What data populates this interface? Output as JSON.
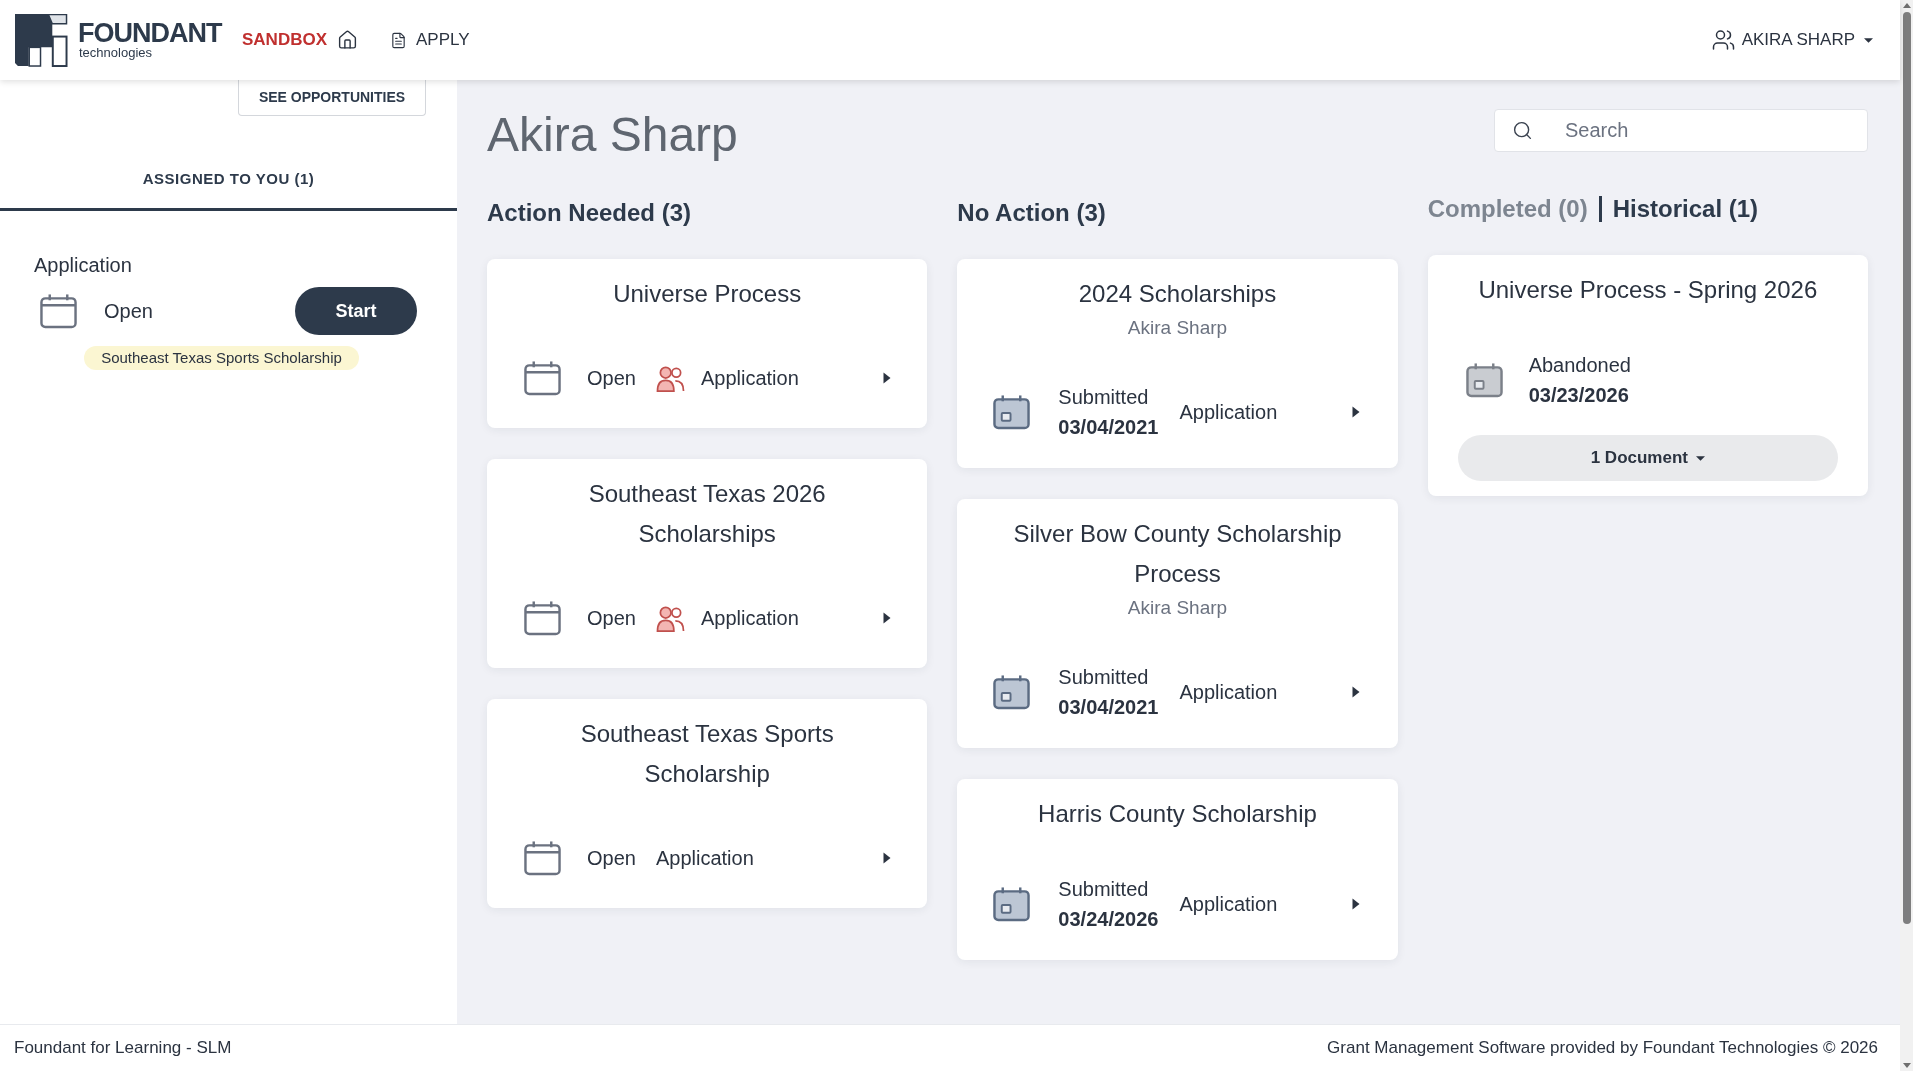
{
  "header": {
    "brand": {
      "name": "FOUNDANT",
      "tagline": "technologies"
    },
    "environment": "SANDBOX",
    "nav_links": [
      "APPLY"
    ],
    "user_menu": "AKIRA SHARP"
  },
  "sidebar": {
    "button": "SEE OPPORTUNITIES",
    "tabs": [
      {
        "label": "ASSIGNED TO YOU (1)",
        "selected": true
      }
    ],
    "tasks": [
      {
        "type": "Application",
        "status": "Open",
        "action": "Start",
        "tag": "Southeast Texas Sports Scholarship"
      }
    ]
  },
  "main": {
    "title": "Akira Sharp",
    "search": {
      "placeholder": "Search"
    },
    "columns": [
      {
        "kind": "open",
        "heading": "Action Needed (3)",
        "cards": [
          {
            "title": "Universe Process",
            "status": "Open",
            "collaborators": true,
            "form": "Application"
          },
          {
            "title": "Southeast Texas 2026 Scholarships",
            "status": "Open",
            "collaborators": true,
            "form": "Application"
          },
          {
            "title": "Southeast Texas Sports Scholarship",
            "status": "Open",
            "collaborators": false,
            "form": "Application"
          }
        ]
      },
      {
        "kind": "submitted",
        "heading": "No Action (3)",
        "cards": [
          {
            "title": "2024 Scholarships",
            "subtitle": "Akira Sharp",
            "status": "Submitted",
            "date": "03/04/2021",
            "form": "Application"
          },
          {
            "title": "Silver Bow County Scholarship Process",
            "subtitle": "Akira Sharp",
            "status": "Submitted",
            "date": "03/04/2021",
            "form": "Application"
          },
          {
            "title": "Harris County Scholarship",
            "status": "Submitted",
            "date": "03/24/2026",
            "form": "Application"
          }
        ]
      },
      {
        "kind": "closed",
        "tabs": [
          {
            "label": "Completed (0)",
            "selected": false
          },
          {
            "label": "Historical (1)",
            "selected": true
          }
        ],
        "cards": [
          {
            "title": "Universe Process - Spring 2026",
            "status": "Abandoned",
            "date": "03/23/2026",
            "documents": "1 Document"
          }
        ]
      }
    ]
  },
  "footer": {
    "left": "Foundant for Learning - SLM",
    "right": "Grant Management Software provided by Foundant Technologies © 2026"
  }
}
